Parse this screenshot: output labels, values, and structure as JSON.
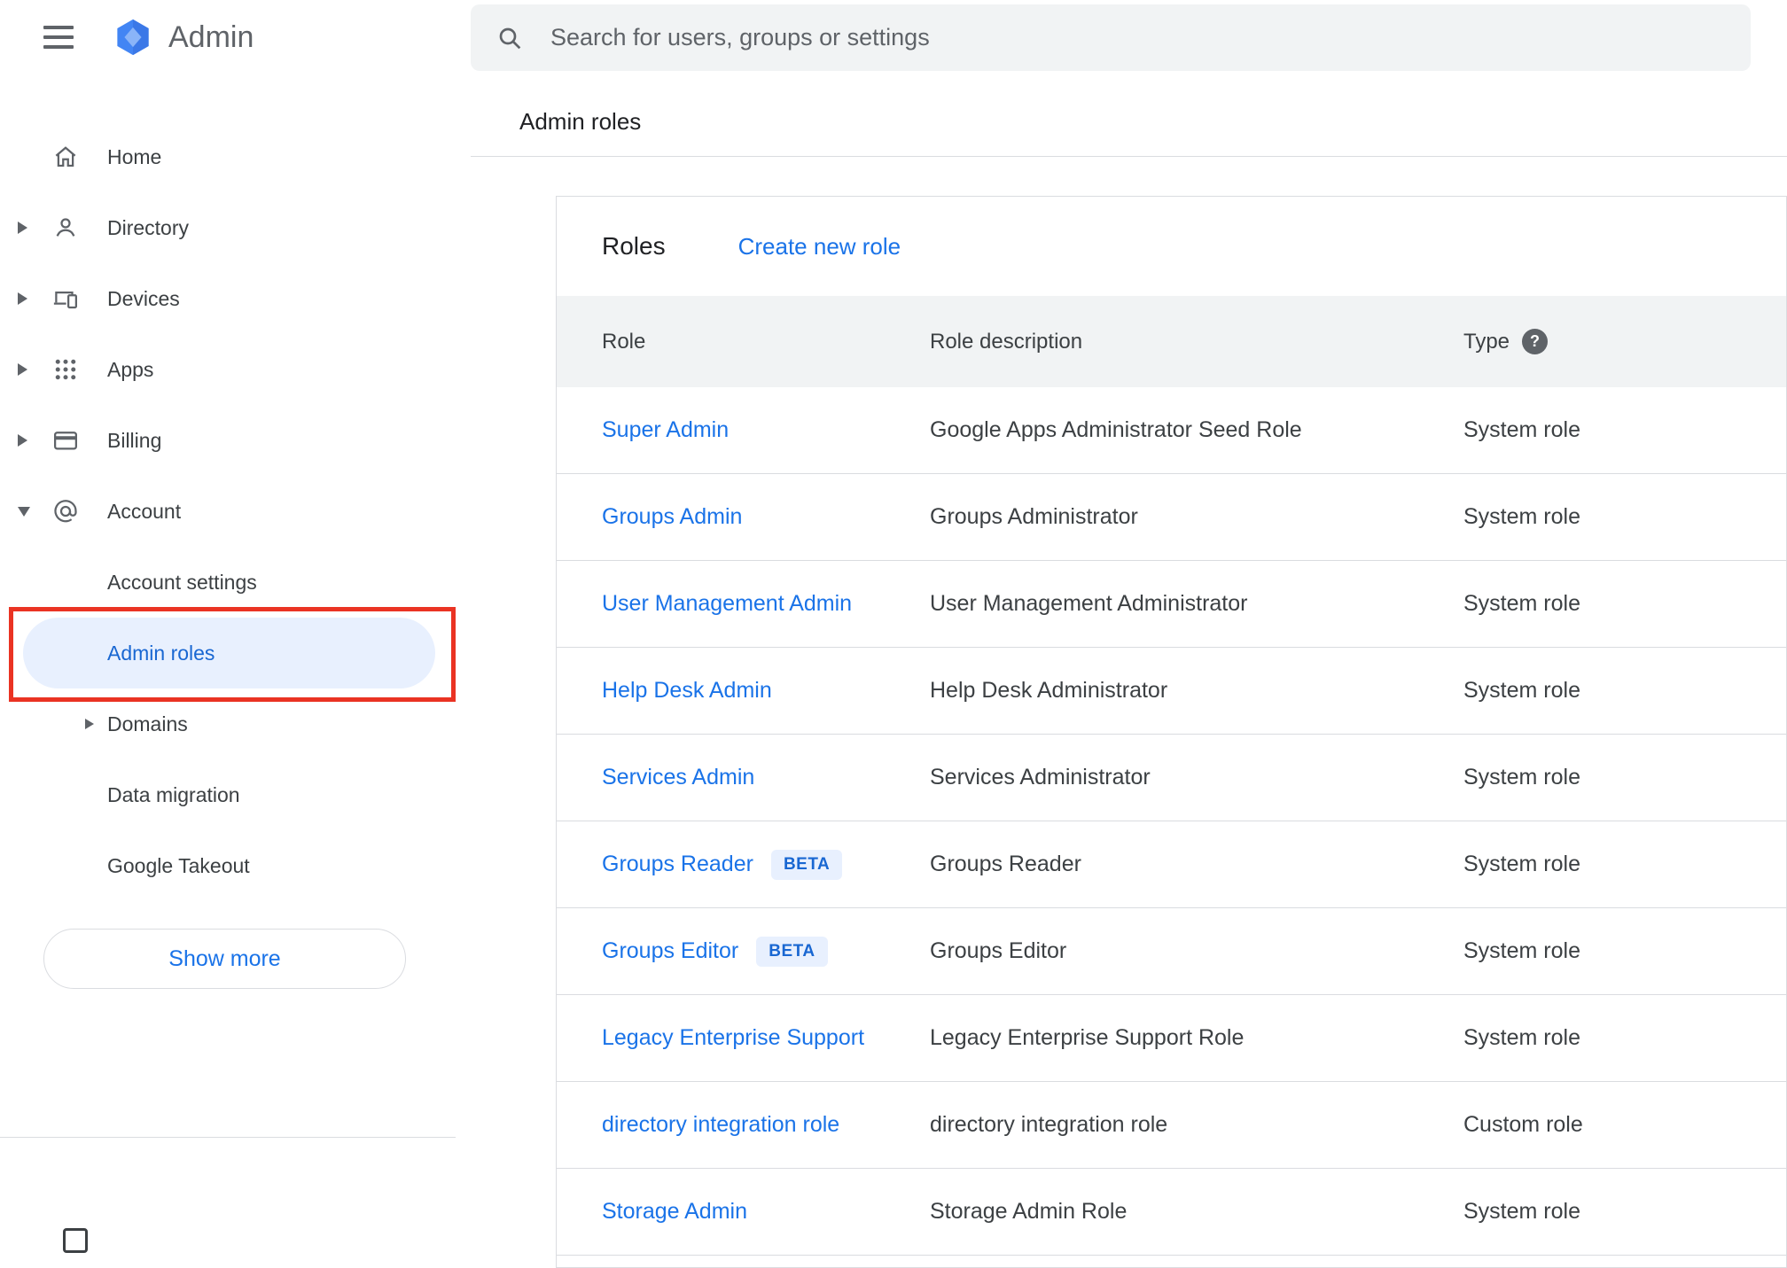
{
  "sidebar": {
    "app_title": "Admin",
    "items": [
      {
        "label": "Home",
        "icon": "home-icon"
      },
      {
        "label": "Directory",
        "icon": "person-icon"
      },
      {
        "label": "Devices",
        "icon": "devices-icon"
      },
      {
        "label": "Apps",
        "icon": "apps-grid-icon"
      },
      {
        "label": "Billing",
        "icon": "credit-card-icon"
      },
      {
        "label": "Account",
        "icon": "at-sign-icon"
      }
    ],
    "account_subitems": [
      {
        "label": "Account settings"
      },
      {
        "label": "Admin roles",
        "selected": true
      },
      {
        "label": "Domains"
      },
      {
        "label": "Data migration"
      },
      {
        "label": "Google Takeout"
      }
    ],
    "show_more_label": "Show more"
  },
  "search": {
    "placeholder": "Search for users, groups or settings"
  },
  "page": {
    "title": "Admin roles"
  },
  "roles_card": {
    "heading": "Roles",
    "create_link_label": "Create new role",
    "beta_label": "BETA",
    "columns": [
      "Role",
      "Role description",
      "Type"
    ],
    "help_glyph": "?",
    "rows": [
      {
        "role": "Super Admin",
        "beta": false,
        "description": "Google Apps Administrator Seed Role",
        "type": "System role"
      },
      {
        "role": "Groups Admin",
        "beta": false,
        "description": "Groups Administrator",
        "type": "System role"
      },
      {
        "role": "User Management Admin",
        "beta": false,
        "description": "User Management Administrator",
        "type": "System role"
      },
      {
        "role": "Help Desk Admin",
        "beta": false,
        "description": "Help Desk Administrator",
        "type": "System role"
      },
      {
        "role": "Services Admin",
        "beta": false,
        "description": "Services Administrator",
        "type": "System role"
      },
      {
        "role": "Groups Reader",
        "beta": true,
        "description": "Groups Reader",
        "type": "System role"
      },
      {
        "role": "Groups Editor",
        "beta": true,
        "description": "Groups Editor",
        "type": "System role"
      },
      {
        "role": "Legacy Enterprise Support",
        "beta": false,
        "description": "Legacy Enterprise Support Role",
        "type": "System role"
      },
      {
        "role": "directory integration role",
        "beta": false,
        "description": "directory integration role",
        "type": "Custom role"
      },
      {
        "role": "Storage Admin",
        "beta": false,
        "description": "Storage Admin Role",
        "type": "System role"
      }
    ]
  },
  "colors": {
    "accent_blue": "#1a73e8",
    "selected_bg": "#e8f0fe",
    "selected_text": "#1967d2",
    "annotation_red": "#ea3323",
    "header_bg": "#f1f3f4",
    "badge_bg": "#e8f0fe",
    "badge_text": "#1967d2"
  }
}
